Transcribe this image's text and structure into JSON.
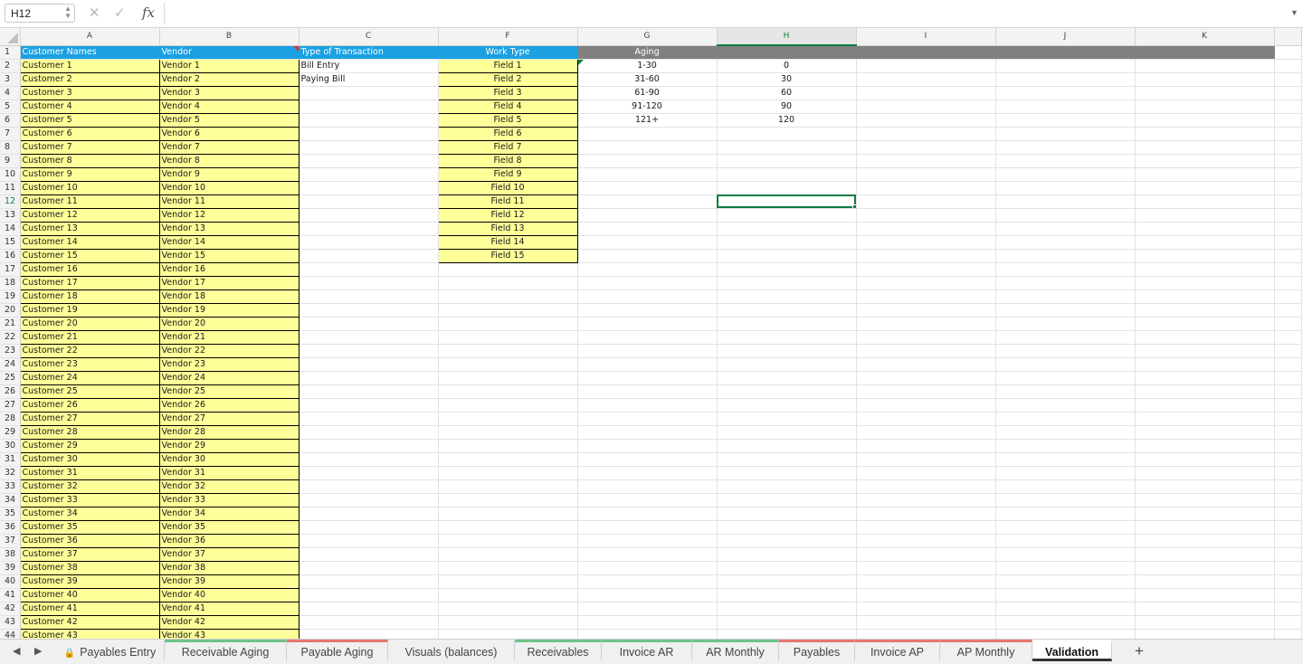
{
  "namebox": {
    "value": "H12"
  },
  "formula": {
    "value": ""
  },
  "columns": [
    "A",
    "B",
    "C",
    "F",
    "G",
    "H",
    "I",
    "J",
    "K"
  ],
  "header_row": {
    "A": "Customer Names",
    "B": "Vendor",
    "C": "Type of Transaction",
    "F": "Work Type",
    "G": "Aging"
  },
  "customers": [
    "Customer 1",
    "Customer 2",
    "Customer 3",
    "Customer 4",
    "Customer 5",
    "Customer 6",
    "Customer 7",
    "Customer 8",
    "Customer 9",
    "Customer 10",
    "Customer 11",
    "Customer 12",
    "Customer 13",
    "Customer 14",
    "Customer 15",
    "Customer 16",
    "Customer 17",
    "Customer 18",
    "Customer 19",
    "Customer 20",
    "Customer 21",
    "Customer 22",
    "Customer 23",
    "Customer 24",
    "Customer 25",
    "Customer 26",
    "Customer 27",
    "Customer 28",
    "Customer 29",
    "Customer 30",
    "Customer 31",
    "Customer 32",
    "Customer 33",
    "Customer 34",
    "Customer 35",
    "Customer 36",
    "Customer 37",
    "Customer 38",
    "Customer 39",
    "Customer 40",
    "Customer 41",
    "Customer 42",
    "Customer 43"
  ],
  "vendors": [
    "Vendor 1",
    "Vendor 2",
    "Vendor 3",
    "Vendor 4",
    "Vendor 5",
    "Vendor 6",
    "Vendor 7",
    "Vendor 8",
    "Vendor 9",
    "Vendor 10",
    "Vendor 11",
    "Vendor 12",
    "Vendor 13",
    "Vendor 14",
    "Vendor 15",
    "Vendor 16",
    "Vendor 17",
    "Vendor 18",
    "Vendor 19",
    "Vendor 20",
    "Vendor 21",
    "Vendor 22",
    "Vendor 23",
    "Vendor 24",
    "Vendor 25",
    "Vendor 26",
    "Vendor 27",
    "Vendor 28",
    "Vendor 29",
    "Vendor 30",
    "Vendor 31",
    "Vendor 32",
    "Vendor 33",
    "Vendor 34",
    "Vendor 35",
    "Vendor 36",
    "Vendor 37",
    "Vendor 38",
    "Vendor 39",
    "Vendor 40",
    "Vendor 41",
    "Vendor 42",
    "Vendor 43"
  ],
  "transaction_types": [
    "Bill Entry",
    "Paying Bill"
  ],
  "work_types": [
    "Field 1",
    "Field 2",
    "Field 3",
    "Field 4",
    "Field 5",
    "Field 6",
    "Field 7",
    "Field 8",
    "Field 9",
    "Field 10",
    "Field 11",
    "Field 12",
    "Field 13",
    "Field 14",
    "Field 15"
  ],
  "aging_labels": [
    "1-30",
    "31-60",
    "61-90",
    "91-120",
    "121+"
  ],
  "aging_values": [
    "0",
    "30",
    "60",
    "90",
    "120"
  ],
  "selected_cell": "H12",
  "colors": {
    "header_blue": "#1ba1e2",
    "header_gray": "#808080",
    "list_yellow": "#ffff99",
    "excel_green": "#107c41"
  },
  "tabs": [
    {
      "label": "Payables Entry",
      "color": "",
      "locked": true
    },
    {
      "label": "Receivable Aging",
      "color": "#70c48a"
    },
    {
      "label": "Payable Aging",
      "color": "#e8766d"
    },
    {
      "label": "Visuals (balances)",
      "color": ""
    },
    {
      "label": "Receivables",
      "color": "#70c48a"
    },
    {
      "label": "Invoice AR",
      "color": "#70c48a"
    },
    {
      "label": "AR Monthly",
      "color": "#70c48a"
    },
    {
      "label": "Payables",
      "color": "#e8766d"
    },
    {
      "label": "Invoice AP",
      "color": "#e8766d"
    },
    {
      "label": "AP Monthly",
      "color": "#e8766d"
    },
    {
      "label": "Validation",
      "color": "",
      "active": true
    }
  ],
  "icons": {
    "cancel": "cancel-icon",
    "enter": "check-icon",
    "fx": "fx-icon",
    "add_sheet": "plus-icon",
    "prev": "prev-sheet-icon",
    "next": "next-sheet-icon",
    "lock": "lock-icon"
  }
}
